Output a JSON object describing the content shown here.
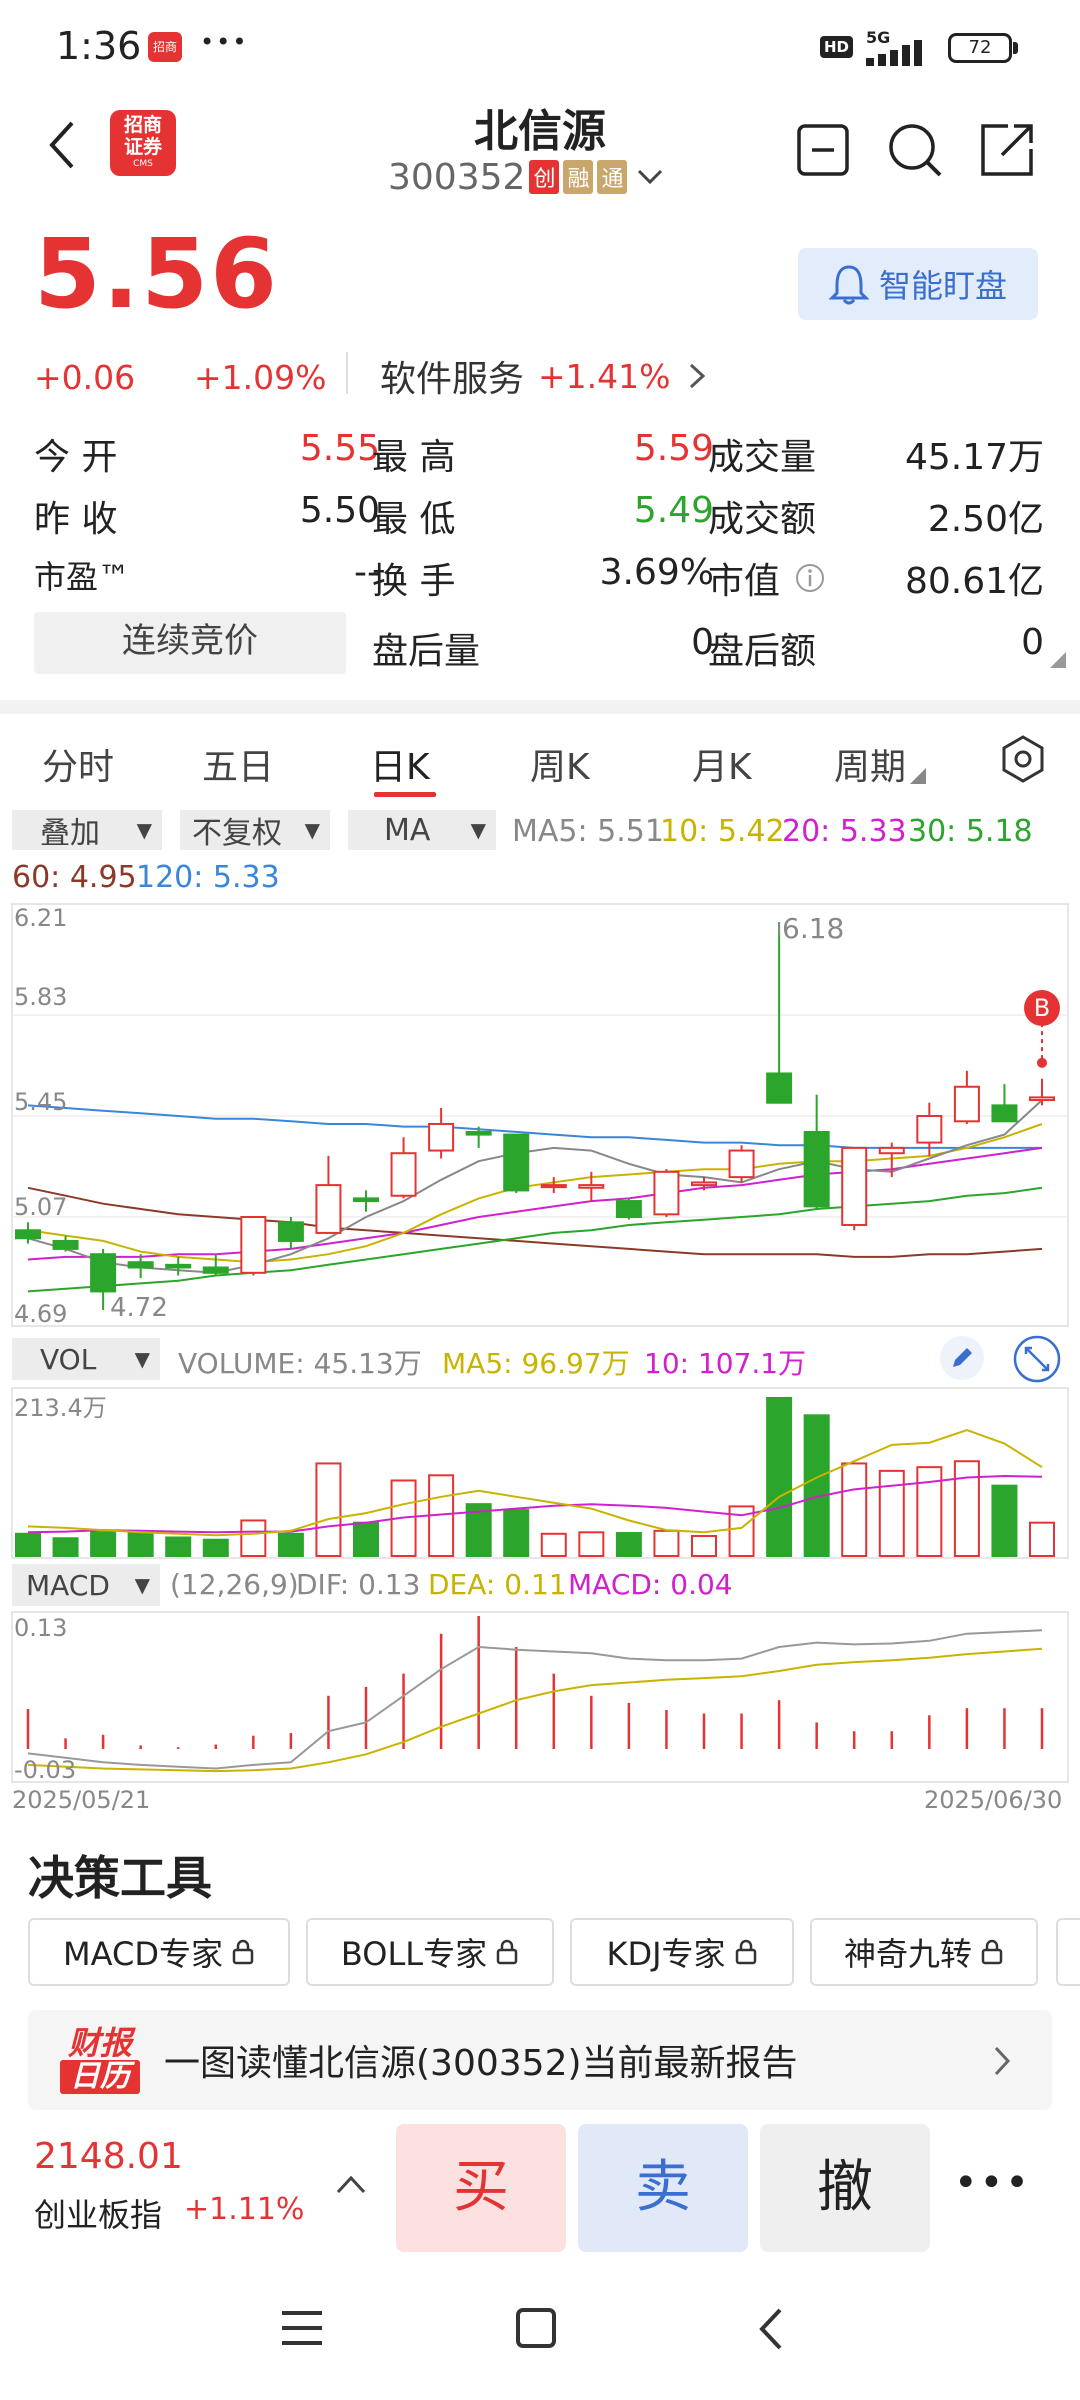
{
  "status_bar": {
    "time": "1:36",
    "app_badge": "招商",
    "dots": "•••",
    "hd": "HD",
    "network": "5G",
    "battery": "72"
  },
  "header": {
    "title": "北信源",
    "code": "300352",
    "tags": [
      "创",
      "融",
      "通"
    ],
    "logo_text_1": "招商",
    "logo_text_2": "证券",
    "logo_text_3": "CMS",
    "smart_watch_label": "智能盯盘"
  },
  "quote": {
    "price": "5.56",
    "change": "+0.06",
    "change_pct": "+1.09%",
    "sector": "软件服务",
    "sector_pct": "+1.41%",
    "rows": [
      [
        {
          "label": "今  开",
          "value": "5.55",
          "color": "red"
        },
        {
          "label": "最  高",
          "value": "5.59",
          "color": "red"
        },
        {
          "label": "成交量",
          "value": "45.17万",
          "color": "black"
        }
      ],
      [
        {
          "label": "昨  收",
          "value": "5.50",
          "color": "black"
        },
        {
          "label": "最  低",
          "value": "5.49",
          "color": "green"
        },
        {
          "label": "成交额",
          "value": "2.50亿",
          "color": "black"
        }
      ],
      [
        {
          "label": "市盈™",
          "value": "--",
          "color": "black"
        },
        {
          "label": "换  手",
          "value": "3.69%",
          "color": "black"
        },
        {
          "label": "市值",
          "value": "80.61亿",
          "color": "black"
        }
      ]
    ],
    "auction_button": "连续竞价",
    "after_volume_label": "盘后量",
    "after_volume": "0",
    "after_amount_label": "盘后额",
    "after_amount": "0"
  },
  "tabs": [
    "分时",
    "五日",
    "日K",
    "周K",
    "月K",
    "周期"
  ],
  "active_tab": "日K",
  "chart_toolbar": {
    "overlay": "叠加",
    "adjust": "不复权",
    "indicator": "MA"
  },
  "ma": {
    "ma5": "MA5: 5.51",
    "ma10": "10: 5.42",
    "ma20": "20: 5.33",
    "ma30": "30: 5.18",
    "ma60": "60: 4.95",
    "ma120": "120: 5.33"
  },
  "colors": {
    "ma5": "#888888",
    "ma10": "#c8b400",
    "ma20": "#d020d0",
    "ma30": "#2ba52b",
    "ma60": "#8b3a2a",
    "ma120": "#3a86d8",
    "up": "#e53333",
    "down": "#2ba52b"
  },
  "kline_axis": {
    "labels": [
      "6.21",
      "5.83",
      "5.45",
      "5.07",
      "4.69"
    ],
    "max_label": "6.18",
    "min_label": "4.72",
    "buy_marker": "B"
  },
  "volume_panel": {
    "selector": "VOL",
    "volume": "VOLUME: 45.13万",
    "ma5": "MA5: 96.97万",
    "ma10": "10: 107.1万",
    "max": "213.4万"
  },
  "macd_panel": {
    "selector": "MACD",
    "params": "(12,26,9)",
    "dif": "DIF: 0.13",
    "dea": "DEA: 0.11",
    "macd": "MACD: 0.04",
    "top": "0.13",
    "bottom": "-0.03"
  },
  "date_range": {
    "start": "2025/05/21",
    "end": "2025/06/30"
  },
  "chart_data": {
    "type": "candlestick",
    "ylim": [
      4.69,
      6.21
    ],
    "candles": [
      {
        "o": 5.02,
        "h": 5.05,
        "l": 4.97,
        "c": 4.99
      },
      {
        "o": 4.98,
        "h": 5.0,
        "l": 4.94,
        "c": 4.95
      },
      {
        "o": 4.93,
        "h": 4.95,
        "l": 4.72,
        "c": 4.79
      },
      {
        "o": 4.9,
        "h": 4.93,
        "l": 4.84,
        "c": 4.88
      },
      {
        "o": 4.89,
        "h": 4.92,
        "l": 4.85,
        "c": 4.88
      },
      {
        "o": 4.88,
        "h": 4.93,
        "l": 4.85,
        "c": 4.86
      },
      {
        "o": 4.86,
        "h": 5.07,
        "l": 4.85,
        "c": 5.07
      },
      {
        "o": 5.05,
        "h": 5.07,
        "l": 4.95,
        "c": 4.98
      },
      {
        "o": 5.01,
        "h": 5.3,
        "l": 5.01,
        "c": 5.19
      },
      {
        "o": 5.14,
        "h": 5.17,
        "l": 5.09,
        "c": 5.13
      },
      {
        "o": 5.15,
        "h": 5.37,
        "l": 5.14,
        "c": 5.31
      },
      {
        "o": 5.32,
        "h": 5.48,
        "l": 5.29,
        "c": 5.42
      },
      {
        "o": 5.39,
        "h": 5.41,
        "l": 5.33,
        "c": 5.38
      },
      {
        "o": 5.38,
        "h": 5.38,
        "l": 5.16,
        "c": 5.17
      },
      {
        "o": 5.19,
        "h": 5.22,
        "l": 5.16,
        "c": 5.19
      },
      {
        "o": 5.18,
        "h": 5.24,
        "l": 5.13,
        "c": 5.19
      },
      {
        "o": 5.13,
        "h": 5.14,
        "l": 5.06,
        "c": 5.07
      },
      {
        "o": 5.08,
        "h": 5.25,
        "l": 5.07,
        "c": 5.24
      },
      {
        "o": 5.19,
        "h": 5.22,
        "l": 5.17,
        "c": 5.2
      },
      {
        "o": 5.22,
        "h": 5.34,
        "l": 5.2,
        "c": 5.32
      },
      {
        "o": 5.61,
        "h": 6.18,
        "l": 5.51,
        "c": 5.5
      },
      {
        "o": 5.39,
        "h": 5.53,
        "l": 5.1,
        "c": 5.11
      },
      {
        "o": 5.04,
        "h": 5.33,
        "l": 5.02,
        "c": 5.33
      },
      {
        "o": 5.31,
        "h": 5.35,
        "l": 5.22,
        "c": 5.33
      },
      {
        "o": 5.35,
        "h": 5.5,
        "l": 5.3,
        "c": 5.45
      },
      {
        "o": 5.43,
        "h": 5.62,
        "l": 5.42,
        "c": 5.56
      },
      {
        "o": 5.49,
        "h": 5.57,
        "l": 5.45,
        "c": 5.43
      },
      {
        "o": 5.51,
        "h": 5.59,
        "l": 5.49,
        "c": 5.52
      }
    ],
    "ma5": [
      4.99,
      4.95,
      4.9,
      4.88,
      4.87,
      4.86,
      4.89,
      4.93,
      4.99,
      5.07,
      5.13,
      5.21,
      5.28,
      5.31,
      5.33,
      5.32,
      5.27,
      5.23,
      5.22,
      5.2,
      5.25,
      5.28,
      5.25,
      5.24,
      5.29,
      5.34,
      5.38,
      5.51
    ],
    "ma10": [
      5.02,
      5.0,
      4.98,
      4.94,
      4.92,
      4.91,
      4.9,
      4.91,
      4.93,
      4.96,
      5.01,
      5.08,
      5.14,
      5.18,
      5.2,
      5.22,
      5.23,
      5.24,
      5.25,
      5.25,
      5.27,
      5.28,
      5.28,
      5.29,
      5.3,
      5.33,
      5.37,
      5.42
    ],
    "ma20": [
      4.91,
      4.92,
      4.92,
      4.92,
      4.93,
      4.93,
      4.94,
      4.95,
      4.97,
      4.99,
      5.01,
      5.04,
      5.07,
      5.09,
      5.11,
      5.13,
      5.14,
      5.16,
      5.18,
      5.19,
      5.21,
      5.23,
      5.24,
      5.25,
      5.27,
      5.29,
      5.31,
      5.33
    ],
    "ma30": [
      4.79,
      4.8,
      4.81,
      4.82,
      4.83,
      4.85,
      4.86,
      4.87,
      4.89,
      4.91,
      4.93,
      4.95,
      4.97,
      4.99,
      5.01,
      5.02,
      5.04,
      5.05,
      5.06,
      5.07,
      5.08,
      5.1,
      5.11,
      5.12,
      5.13,
      5.15,
      5.16,
      5.18
    ],
    "ma60": [
      5.18,
      5.15,
      5.12,
      5.1,
      5.08,
      5.07,
      5.06,
      5.05,
      5.03,
      5.02,
      5.01,
      5.0,
      4.99,
      4.98,
      4.97,
      4.96,
      4.95,
      4.94,
      4.93,
      4.93,
      4.93,
      4.93,
      4.92,
      4.92,
      4.93,
      4.93,
      4.94,
      4.95
    ],
    "ma120": [
      5.49,
      5.48,
      5.47,
      5.46,
      5.45,
      5.44,
      5.44,
      5.43,
      5.42,
      5.42,
      5.41,
      5.41,
      5.4,
      5.39,
      5.38,
      5.37,
      5.37,
      5.36,
      5.35,
      5.35,
      5.34,
      5.34,
      5.33,
      5.33,
      5.33,
      5.33,
      5.33,
      5.33
    ],
    "volume": [
      30,
      24,
      32,
      31,
      25,
      22,
      48,
      30,
      125,
      45,
      102,
      109,
      70,
      62,
      30,
      32,
      31,
      34,
      27,
      67,
      213.4,
      190,
      125,
      115,
      120,
      128,
      95,
      45
    ],
    "vol_ma5": [
      40,
      38,
      35,
      32,
      30,
      28,
      30,
      34,
      50,
      58,
      70,
      80,
      88,
      80,
      72,
      64,
      48,
      35,
      32,
      38,
      80,
      106,
      128,
      150,
      153,
      170,
      152,
      120
    ],
    "vol_ma10": [
      32,
      33,
      35,
      34,
      33,
      32,
      33,
      33,
      40,
      45,
      52,
      56,
      60,
      64,
      68,
      70,
      68,
      65,
      60,
      55,
      65,
      80,
      90,
      95,
      100,
      106,
      108,
      107
    ],
    "dif": [
      -0.005,
      -0.01,
      -0.015,
      -0.018,
      -0.02,
      -0.022,
      -0.018,
      -0.015,
      0.02,
      0.03,
      0.06,
      0.09,
      0.115,
      0.112,
      0.11,
      0.108,
      0.102,
      0.1,
      0.1,
      0.102,
      0.115,
      0.12,
      0.118,
      0.119,
      0.122,
      0.13,
      0.132,
      0.134
    ],
    "dea": [
      -0.018,
      -0.02,
      -0.022,
      -0.023,
      -0.024,
      -0.025,
      -0.024,
      -0.022,
      -0.015,
      -0.006,
      0.008,
      0.025,
      0.04,
      0.055,
      0.065,
      0.072,
      0.075,
      0.078,
      0.08,
      0.082,
      0.088,
      0.095,
      0.098,
      0.1,
      0.103,
      0.107,
      0.11,
      0.113
    ],
    "macd": [
      0.045,
      0.012,
      0.016,
      0.004,
      0.002,
      0.005,
      0.015,
      0.018,
      0.06,
      0.07,
      0.085,
      0.13,
      0.15,
      0.115,
      0.085,
      0.06,
      0.052,
      0.044,
      0.04,
      0.04,
      0.055,
      0.03,
      0.02,
      0.02,
      0.038,
      0.046,
      0.046,
      0.046
    ]
  },
  "decision_tools": {
    "title": "决策工具",
    "items": [
      "MACD专家",
      "BOLL专家",
      "KDJ专家",
      "神奇九转"
    ]
  },
  "report_banner": {
    "logo_1": "财报",
    "logo_2": "日历",
    "text": "一图读懂北信源(300352)当前最新报告"
  },
  "bottom_bar": {
    "index_value": "2148.01",
    "index_name": "创业板指",
    "index_pct": "+1.11%",
    "buy": "买",
    "sell": "卖",
    "cancel": "撤",
    "more": "•••"
  }
}
